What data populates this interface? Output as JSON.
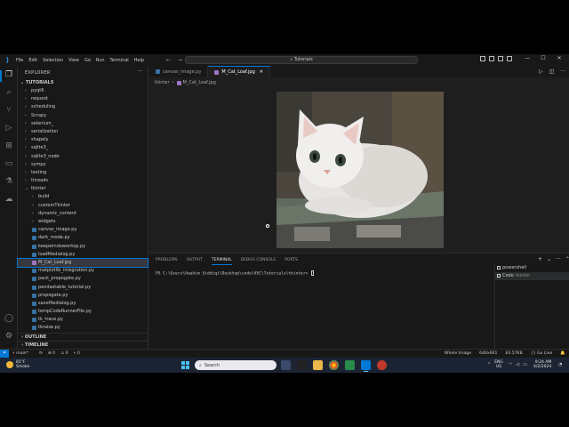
{
  "titlebar": {
    "logo": "vscode-logo",
    "menu": [
      "File",
      "Edit",
      "Selection",
      "View",
      "Go",
      "Run",
      "Terminal",
      "Help"
    ],
    "search": "Tutorials"
  },
  "explorer": {
    "title": "EXPLORER",
    "folder": "TUTORIALS",
    "tree": [
      {
        "label": "pyqt6",
        "kind": "folder",
        "depth": 0,
        "open": false
      },
      {
        "label": "request",
        "kind": "folder",
        "depth": 0,
        "open": false
      },
      {
        "label": "scheduling",
        "kind": "folder",
        "depth": 0,
        "open": false
      },
      {
        "label": "Scrapy",
        "kind": "folder",
        "depth": 0,
        "open": false
      },
      {
        "label": "selenium_",
        "kind": "folder",
        "depth": 0,
        "open": false
      },
      {
        "label": "serialization",
        "kind": "folder",
        "depth": 0,
        "open": false
      },
      {
        "label": "shapely",
        "kind": "folder",
        "depth": 0,
        "open": false
      },
      {
        "label": "sqlite3_",
        "kind": "folder",
        "depth": 0,
        "open": false
      },
      {
        "label": "sqlite3_node",
        "kind": "folder",
        "depth": 0,
        "open": false
      },
      {
        "label": "sympy",
        "kind": "folder",
        "depth": 0,
        "open": false
      },
      {
        "label": "testing",
        "kind": "folder",
        "depth": 0,
        "open": false
      },
      {
        "label": "threads",
        "kind": "folder",
        "depth": 0,
        "open": false
      },
      {
        "label": "tkinter",
        "kind": "folder",
        "depth": 0,
        "open": true
      },
      {
        "label": "build",
        "kind": "folder",
        "depth": 1,
        "open": false
      },
      {
        "label": "customTkinter",
        "kind": "folder",
        "depth": 1,
        "open": false
      },
      {
        "label": "dynamic_content",
        "kind": "folder",
        "depth": 1,
        "open": false
      },
      {
        "label": "widgets",
        "kind": "folder",
        "depth": 1,
        "open": false
      },
      {
        "label": "canvas_image.py",
        "kind": "py",
        "depth": 1
      },
      {
        "label": "dark_mode.py",
        "kind": "py",
        "depth": 1
      },
      {
        "label": "keepwindowontop.py",
        "kind": "py",
        "depth": 1
      },
      {
        "label": "loadfiledialog.py",
        "kind": "py",
        "depth": 1
      },
      {
        "label": "M_Cat_Loaf.jpg",
        "kind": "img",
        "depth": 1,
        "selected": true
      },
      {
        "label": "matplotlib_integration.py",
        "kind": "py",
        "depth": 1
      },
      {
        "label": "pack_propogate.py",
        "kind": "py",
        "depth": 1
      },
      {
        "label": "pandastable_tutorial.py",
        "kind": "py",
        "depth": 1
      },
      {
        "label": "propogate.py",
        "kind": "py",
        "depth": 1
      },
      {
        "label": "savefiledialog.py",
        "kind": "py",
        "depth": 1
      },
      {
        "label": "tempCodeRunnerFile.py",
        "kind": "py",
        "depth": 1
      },
      {
        "label": "tk_trace.py",
        "kind": "py",
        "depth": 1
      },
      {
        "label": "tkraise.py",
        "kind": "py",
        "depth": 1
      }
    ],
    "outline": "OUTLINE",
    "timeline": "TIMELINE"
  },
  "tabs": [
    {
      "label": "canvas_image.py",
      "active": false
    },
    {
      "label": "M_Cat_Loaf.jpg",
      "active": true
    }
  ],
  "breadcrumb": [
    "tkinter",
    "M_Cat_Loaf.jpg"
  ],
  "panel": {
    "tabs": [
      "PROBLEMS",
      "OUTPUT",
      "TERMINAL",
      "DEBUG CONSOLE",
      "PORTS"
    ],
    "active_tab": "TERMINAL",
    "prompt": "PS C:\\Users\\Haahim Siddiqi\\Desktop\\code\\VSC\\Tutorials\\tkinter> ",
    "terminals": [
      {
        "label": "powershell",
        "sub": "",
        "active": false
      },
      {
        "label": "Code",
        "sub": "tkinter",
        "active": true
      }
    ]
  },
  "statusbar": {
    "branch": "main*",
    "sync": "⟳",
    "errors": "⊗ 0",
    "warnings": "⚠ 0",
    "ports": "⑂ 0",
    "right": [
      "Whole Image",
      "640x601",
      "83.57KB",
      "{} Go Live",
      "🔔"
    ]
  },
  "taskbar": {
    "temp": "81°F",
    "condition": "Smoke",
    "search": "Search",
    "lang_top": "ENG",
    "lang_bottom": "US",
    "time": "9:24 AM",
    "date": "4/2/2024"
  }
}
